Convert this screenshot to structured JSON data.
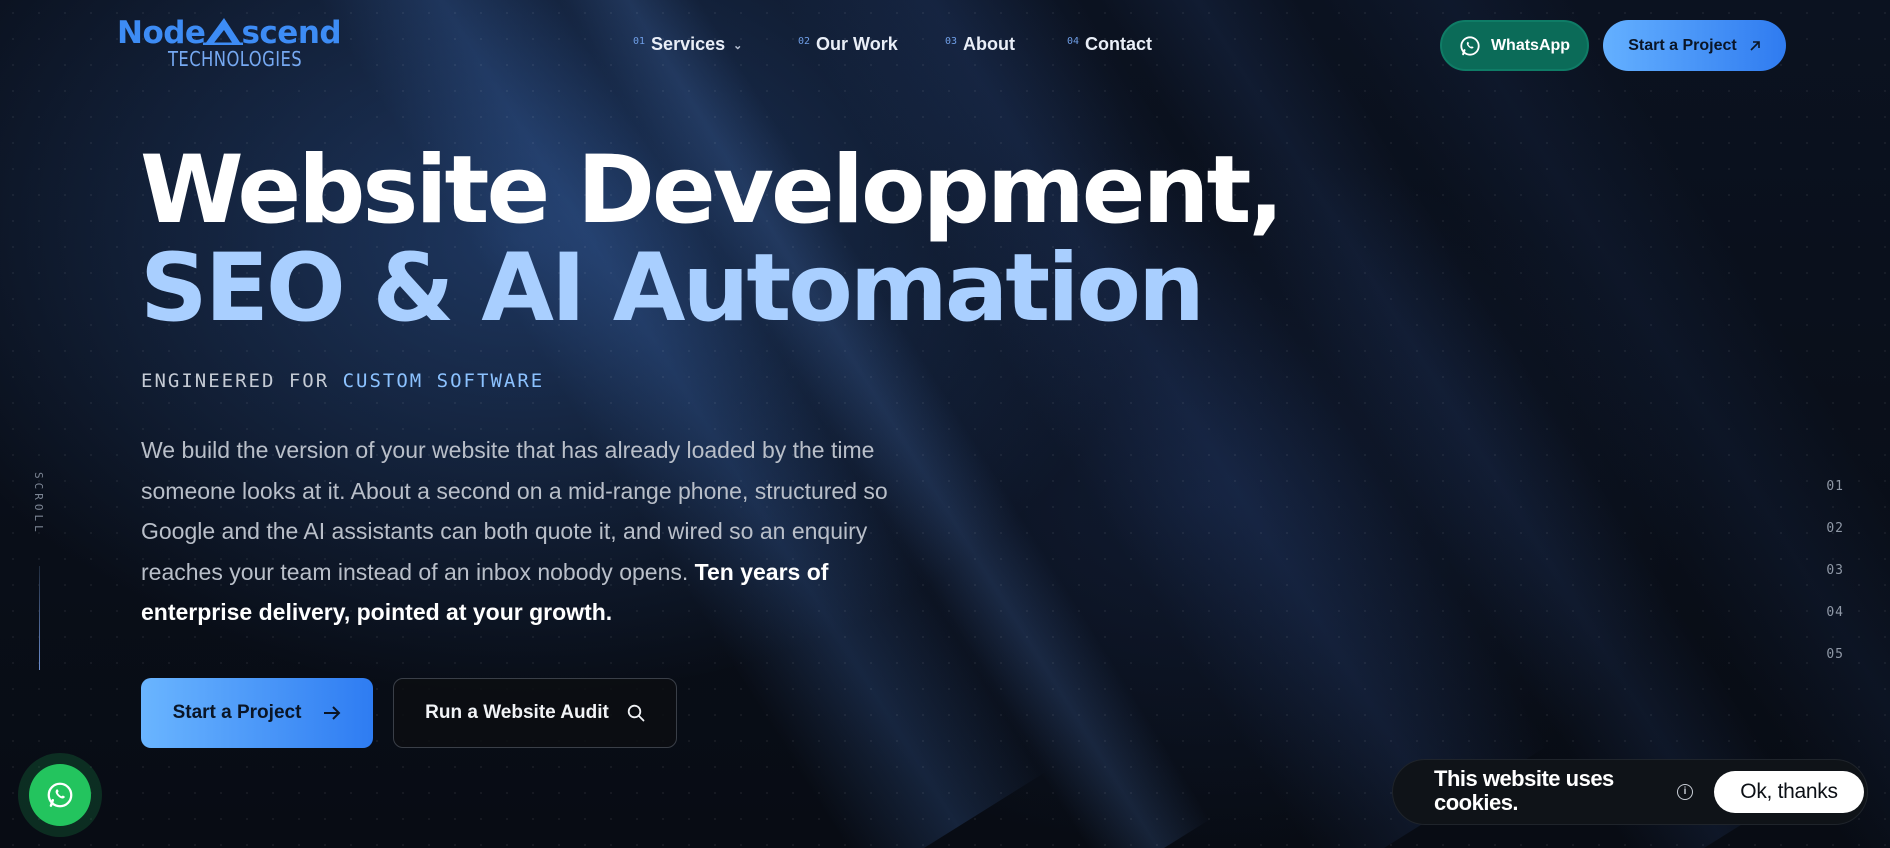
{
  "logo": {
    "wordmark_left": "Node",
    "wordmark_right": "scend",
    "subtitle": "TECHNOLOGIES"
  },
  "nav": [
    {
      "num": "01",
      "label": "Services",
      "has_dropdown": true
    },
    {
      "num": "02",
      "label": "Our Work"
    },
    {
      "num": "03",
      "label": "About"
    },
    {
      "num": "04",
      "label": "Contact"
    }
  ],
  "header_buttons": {
    "whatsapp": "WhatsApp",
    "start_project": "Start a Project"
  },
  "hero": {
    "title_line1": "Website Development,",
    "title_line2": "SEO & AI Automation",
    "kicker_prefix": "ENGINEERED FOR",
    "kicker_accent": "CUSTOM SOFTWARE",
    "paragraph": "We build the version of your website that has already loaded by the time someone looks at it. About a second on a mid-range phone, structured so Google and the AI assistants can both quote it, and wired so an enquiry reaches your team instead of an inbox nobody opens.",
    "paragraph_bold": "Ten years of enterprise delivery, pointed at your growth.",
    "cta_primary": "Start a Project",
    "cta_secondary": "Run a Website Audit"
  },
  "scroll_label": "SCROLL",
  "section_index": [
    "01",
    "02",
    "03",
    "04",
    "05"
  ],
  "cookie": {
    "message": "This website uses cookies.",
    "accept": "Ok, thanks"
  },
  "colors": {
    "accent": "#3d8cf5",
    "accent_light": "#a9cfff",
    "whatsapp": "#23c45e",
    "background": "#080c14"
  }
}
